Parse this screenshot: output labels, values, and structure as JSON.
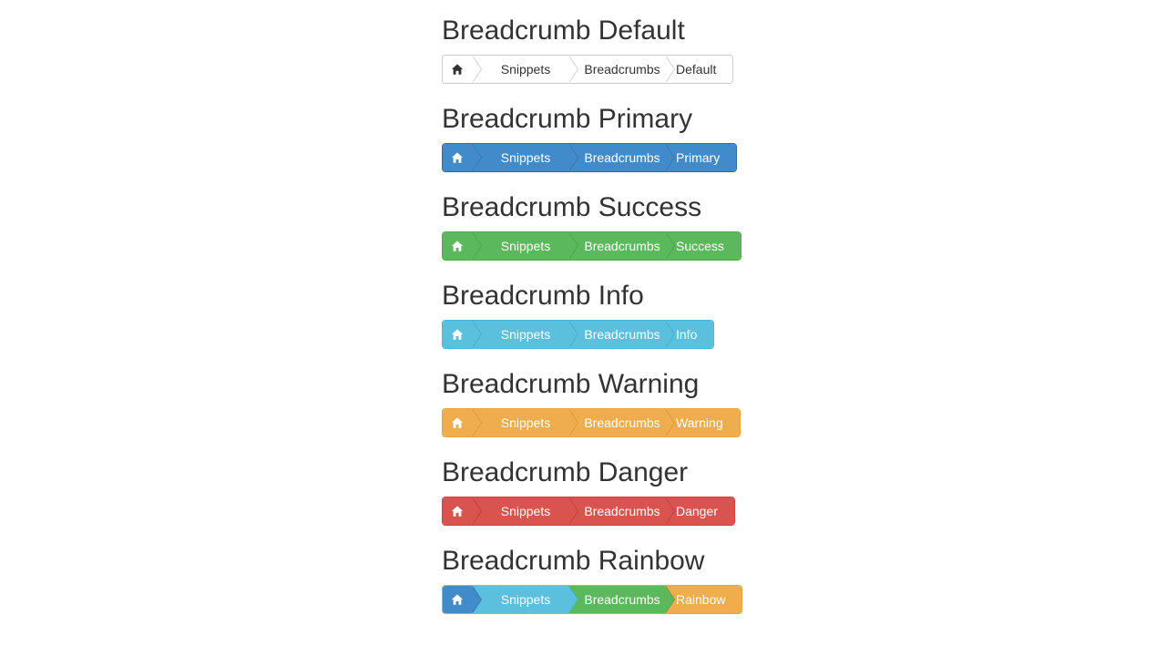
{
  "sections": [
    {
      "title": "Breadcrumb Default",
      "theme": "default",
      "items": [
        "Snippets",
        "Breadcrumbs",
        "Default"
      ]
    },
    {
      "title": "Breadcrumb Primary",
      "theme": "primary",
      "items": [
        "Snippets",
        "Breadcrumbs",
        "Primary"
      ]
    },
    {
      "title": "Breadcrumb Success",
      "theme": "success",
      "items": [
        "Snippets",
        "Breadcrumbs",
        "Success"
      ]
    },
    {
      "title": "Breadcrumb Info",
      "theme": "info",
      "items": [
        "Snippets",
        "Breadcrumbs",
        "Info"
      ]
    },
    {
      "title": "Breadcrumb Warning",
      "theme": "warning",
      "items": [
        "Snippets",
        "Breadcrumbs",
        "Warning"
      ]
    },
    {
      "title": "Breadcrumb Danger",
      "theme": "danger",
      "items": [
        "Snippets",
        "Breadcrumbs",
        "Danger"
      ]
    },
    {
      "title": "Breadcrumb Rainbow",
      "theme": "rainbow",
      "items": [
        "Snippets",
        "Breadcrumbs",
        "Rainbow"
      ]
    }
  ],
  "home_icon": "home-icon",
  "colors": {
    "primary": "#428bca",
    "success": "#5cb85c",
    "info": "#5bc0de",
    "warning": "#f0ad4e",
    "danger": "#d9534f",
    "text": "#333333"
  }
}
